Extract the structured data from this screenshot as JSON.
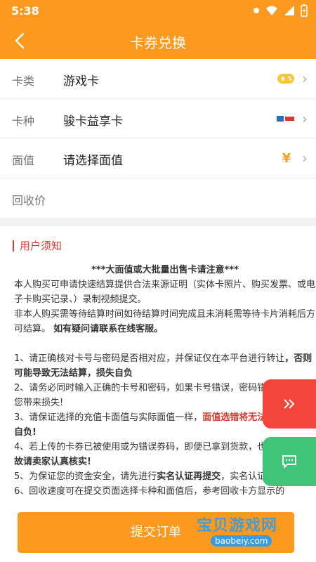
{
  "statusbar": {
    "time": "5:38"
  },
  "header": {
    "title": "卡券兑换"
  },
  "form": {
    "card_type": {
      "label": "卡类",
      "value": "游戏卡"
    },
    "card_kind": {
      "label": "卡种",
      "value": "骏卡益享卡"
    },
    "face_value": {
      "label": "面值",
      "value": "请选择面值",
      "icon": "¥"
    },
    "recycle_price": {
      "label": "回收价",
      "value": ""
    }
  },
  "notice": {
    "title": "用户须知",
    "heading": "***大面值或大批量出售卡请注意***",
    "para1": "本人购买可申请快速结算提供合法来源证明（实体卡照片、购买发票、或电子卡购买记录、）录制视频提交。",
    "para2_a": "非本人购买需等待结算时间如待结算时间完成且未消耗需等待卡片消耗后方可结算。",
    "para2_b": "如有疑问请联系在线客服。",
    "item1_a": "1、请正确核对卡号与密码是否相对应，并保证仅在本平台进行转让",
    "item1_b": "，否则可能导致无法结算，损失自负",
    "item2": "2、请务必同时输入正确的卡号和密码，如果卡号错误，密码错误会可能给您带来损失!",
    "item3_a": "3、请保证选择的充值卡面值与实际面值一样，",
    "item3_b": "面值选错将无法结算",
    "item3_c": "，损失自负!",
    "item4_a": "4、若上传的卡券已被使用或为错误券码，即便已拿到货款，也会被追责，",
    "item4_b": "故请卖家认真核实!",
    "item5_a": "5、为保证您的资金安全，请先进行",
    "item5_b": "实名认证再提交",
    "item5_c": "，实名认证后方可提现!",
    "item6": "6、回收速度可在提交页面选择卡种和面值后，参考回收卡方显示的"
  },
  "submit": {
    "label": "提交订单"
  },
  "watermark": {
    "line1": "宝贝游戏网",
    "line2": "baobeiy.com"
  },
  "colors": {
    "accent": "#fb9a1e",
    "alert": "#e0372c",
    "float_red": "#f4453c",
    "float_green": "#3fc47a"
  }
}
